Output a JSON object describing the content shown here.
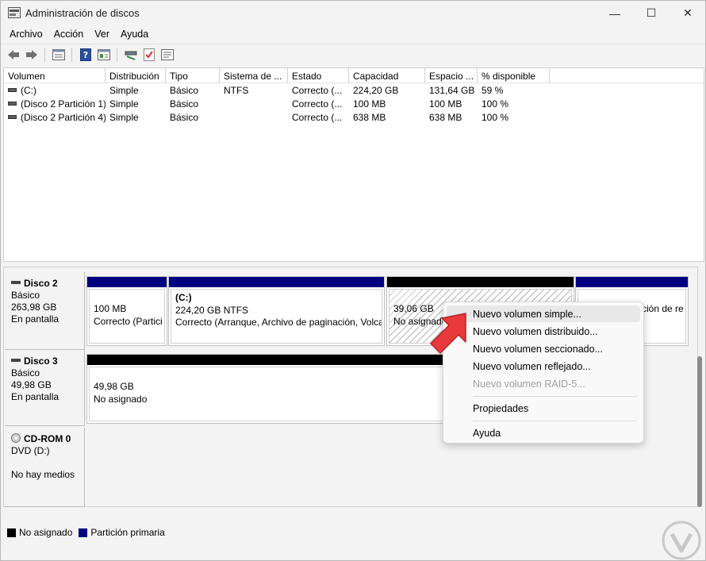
{
  "window": {
    "title": "Administración de discos"
  },
  "window_controls": {
    "minimize": "—",
    "maximize": "☐",
    "close": "✕"
  },
  "menu": [
    "Archivo",
    "Acción",
    "Ver",
    "Ayuda"
  ],
  "toolbar": [
    "back-arrow-icon",
    "forward-arrow-icon",
    "disk-view-icon",
    "help-icon",
    "list-view-icon",
    "connect-icon",
    "check-icon",
    "properties-icon"
  ],
  "volume_list": {
    "columns": [
      "Volumen",
      "Distribución",
      "Tipo",
      "Sistema de ...",
      "Estado",
      "Capacidad",
      "Espacio ...",
      "% disponible"
    ],
    "rows": [
      [
        "(C:)",
        "Simple",
        "Básico",
        "NTFS",
        "Correcto (...",
        "224,20 GB",
        "131,64 GB",
        "59 %"
      ],
      [
        "(Disco 2 Partición 1)",
        "Simple",
        "Básico",
        "",
        "Correcto (...",
        "100 MB",
        "100 MB",
        "100 %"
      ],
      [
        "(Disco 2 Partición 4)",
        "Simple",
        "Básico",
        "",
        "Correcto (...",
        "638 MB",
        "638 MB",
        "100 %"
      ]
    ]
  },
  "disks": [
    {
      "name": "Disco 2",
      "type": "Básico",
      "size": "263,98 GB",
      "status": "En pantalla",
      "partitions": [
        {
          "title": "",
          "size": "100 MB",
          "status": "Correcto (Partici"
        },
        {
          "title": "(C:)",
          "size": "224,20 GB NTFS",
          "status": "Correcto (Arranque, Archivo de paginación, Volca"
        },
        {
          "title": "",
          "size": "39,06 GB",
          "status": "No asignado"
        },
        {
          "title": "",
          "size": "",
          "status": "ción de re"
        }
      ]
    },
    {
      "name": "Disco 3",
      "type": "Básico",
      "size": "49,98 GB",
      "status": "En pantalla",
      "partitions": [
        {
          "title": "",
          "size": "49,98 GB",
          "status": "No asignado"
        }
      ]
    },
    {
      "name": "CD-ROM 0",
      "type": "DVD (D:)",
      "size": "",
      "status": "No hay medios",
      "partitions": []
    }
  ],
  "legend": [
    {
      "label": "No asignado",
      "color": "#000000"
    },
    {
      "label": "Partición primaria",
      "color": "#000080"
    }
  ],
  "context_menu": [
    {
      "label": "Nuevo volumen simple...",
      "enabled": true,
      "highlighted": true
    },
    {
      "label": "Nuevo volumen distribuido...",
      "enabled": true
    },
    {
      "label": "Nuevo volumen seccionado...",
      "enabled": true
    },
    {
      "label": "Nuevo volumen reflejado...",
      "enabled": true
    },
    {
      "label": "Nuevo volumen RAID-5...",
      "enabled": false
    },
    {
      "label": "Propiedades",
      "enabled": true
    },
    {
      "label": "Ayuda",
      "enabled": true
    }
  ],
  "colors": {
    "primary_partition": "#000080",
    "unallocated": "#000000",
    "pointer_arrow": "#e8393d"
  }
}
